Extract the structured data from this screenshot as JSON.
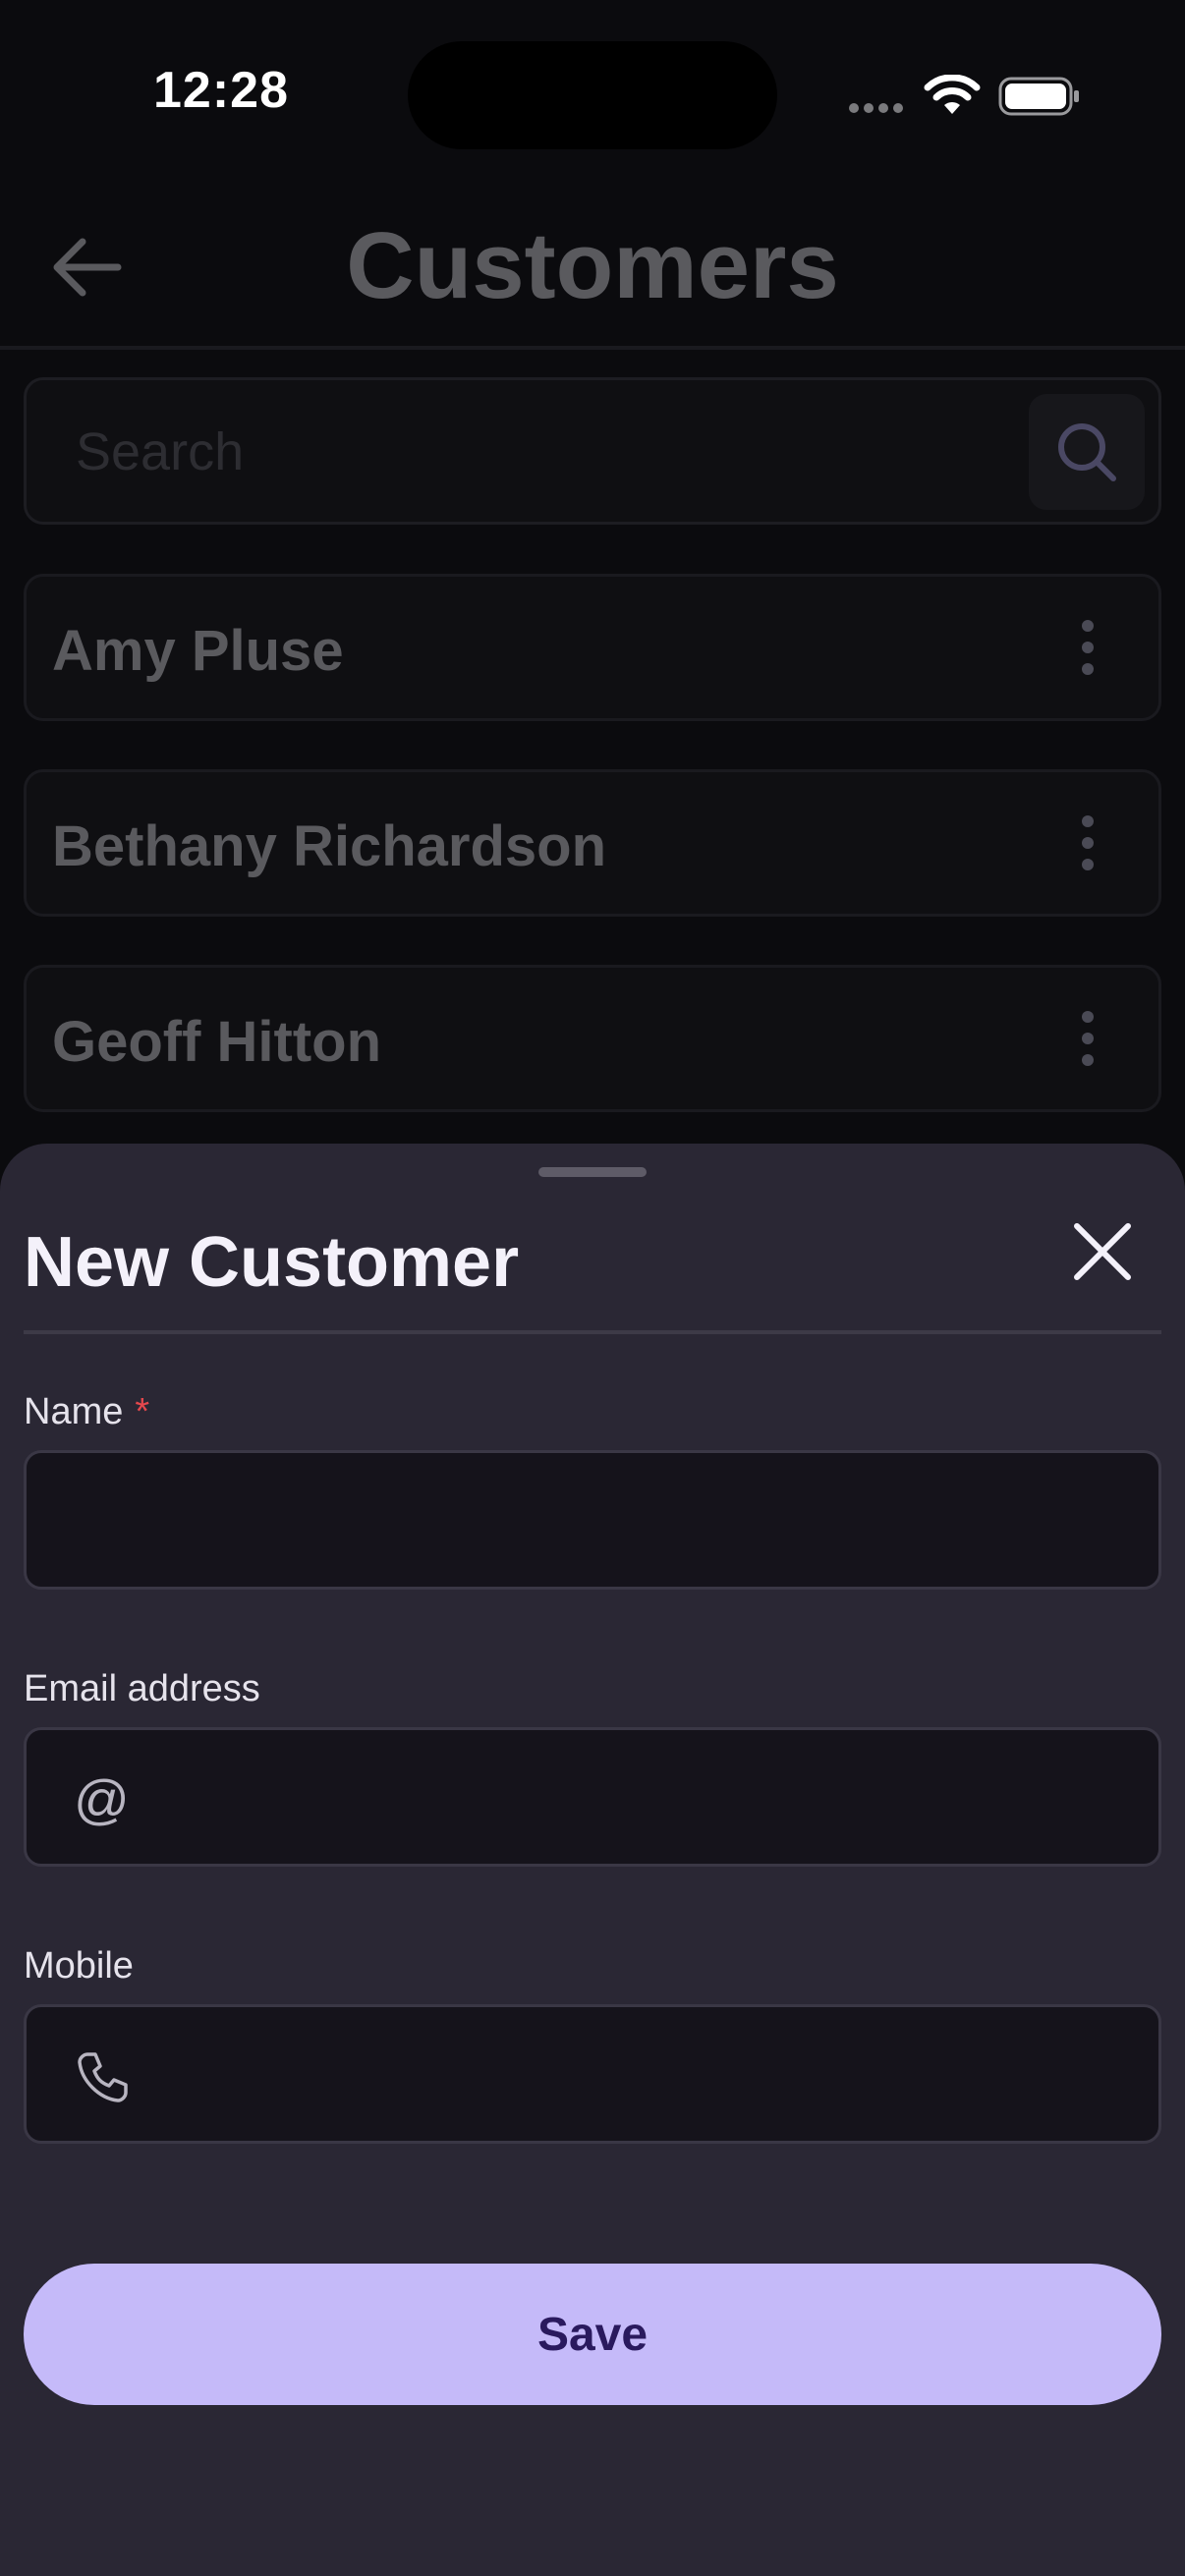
{
  "status_bar": {
    "time": "12:28"
  },
  "header": {
    "title": "Customers"
  },
  "search": {
    "placeholder": "Search"
  },
  "customers": [
    {
      "name": "Amy Pluse"
    },
    {
      "name": "Bethany Richardson"
    },
    {
      "name": "Geoff Hitton"
    }
  ],
  "sheet": {
    "title": "New Customer",
    "fields": {
      "name": {
        "label": "Name",
        "required_mark": "*",
        "value": ""
      },
      "email": {
        "label": "Email address",
        "icon_text": "@",
        "value": ""
      },
      "mobile": {
        "label": "Mobile",
        "value": ""
      }
    },
    "save_label": "Save"
  },
  "colors": {
    "accent": "#c5baf9",
    "sheet_background": "#2a2734",
    "required": "#e5484d"
  },
  "icons": {
    "back": "arrow-left-icon",
    "search": "search-icon",
    "more": "more-vertical-icon",
    "close": "close-icon",
    "email": "at-icon",
    "mobile": "phone-icon"
  }
}
